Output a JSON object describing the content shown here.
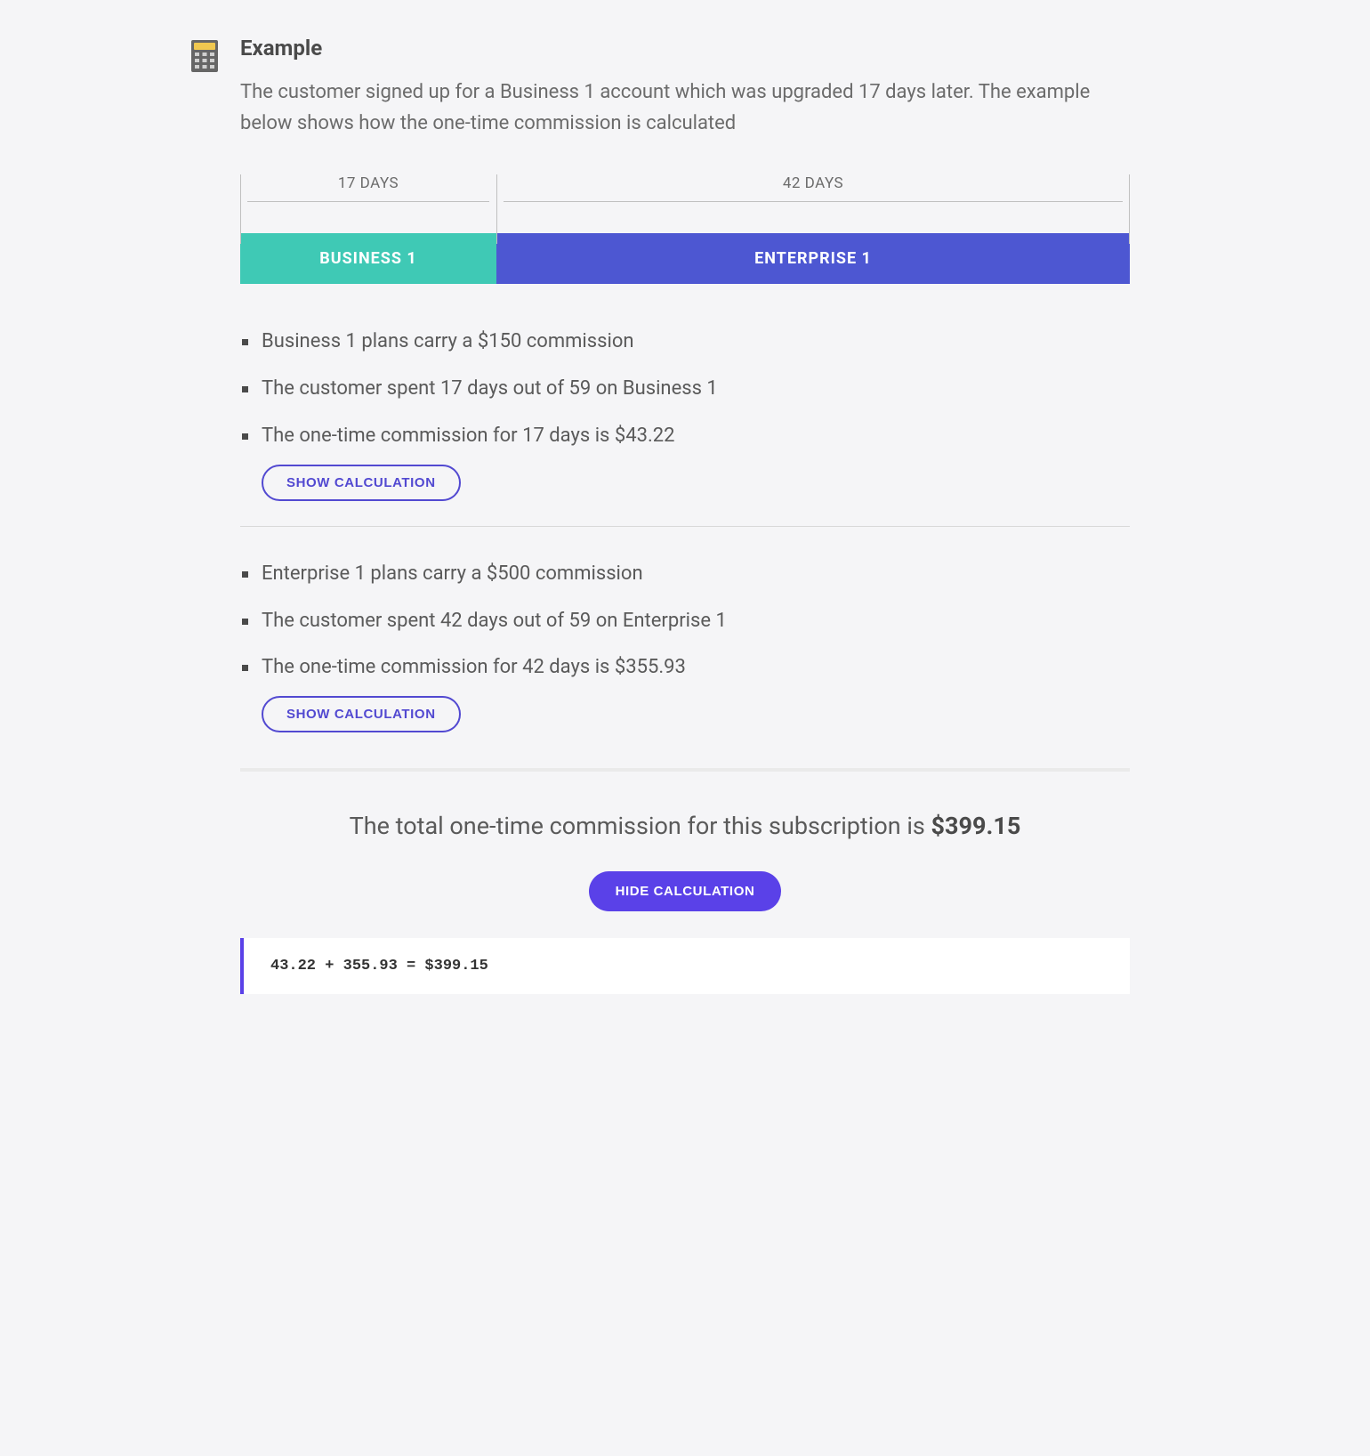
{
  "heading": "Example",
  "intro": "The customer signed up for a Business 1 account which was upgraded 17 days later. The example below shows how the one-time commission is calculated",
  "timeline": {
    "seg1": "17 DAYS",
    "seg2": "42 DAYS"
  },
  "plans": {
    "business": "BUSINESS 1",
    "enterprise": "ENTERPRISE 1"
  },
  "business_list": {
    "item1": "Business 1 plans carry a $150 commission",
    "item2": "The customer spent 17 days out of 59 on Business 1",
    "item3": "The one-time commission for 17 days is $43.22"
  },
  "enterprise_list": {
    "item1": "Enterprise 1 plans carry a $500 commission",
    "item2": "The customer spent 42 days out of 59 on Enterprise 1",
    "item3": "The one-time commission for 42 days is $355.93"
  },
  "buttons": {
    "show": "SHOW CALCULATION",
    "hide": "HIDE CALCULATION"
  },
  "total": {
    "prefix": "The total one-time commission for this subscription is ",
    "amount": "$399.15"
  },
  "calculation": "43.22 + 355.93 = $399.15"
}
